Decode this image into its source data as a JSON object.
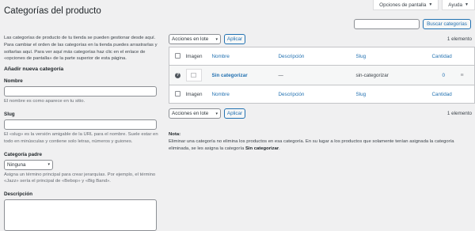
{
  "screen_options": {
    "screen_options_label": "Opciones de pantalla",
    "help_label": "Ayuda"
  },
  "page": {
    "title": "Categorías del producto"
  },
  "search": {
    "button_label": "Buscar categorías",
    "value": ""
  },
  "intro": "Las categorías de producto de tu tienda se pueden gestionar desde aquí. Para cambiar el orden de las categorías en la tienda puedes arrastrarlas y soltarlas aquí. Para ver aquí más categorías haz clic en el enlace de «opciones de pantalla» de la parte superior de esta página.",
  "form": {
    "heading": "Añadir nueva categoría",
    "name_label": "Nombre",
    "name_desc": "El nombre es como aparece en tu sitio.",
    "slug_label": "Slug",
    "slug_desc": "El «slug» es la versión amigable de la URL para el nombre. Suele estar en todo en minúsculas y contiene solo letras, números y guiones.",
    "parent_label": "Categoría padre",
    "parent_value": "Ninguna",
    "parent_desc": "Asigna un término principal para crear jerarquías. Por ejemplo, el término «Jazz» sería el principal de «Bebop» y «Big Band».",
    "description_label": "Descripción"
  },
  "tablenav": {
    "bulk_label": "Acciones en lote",
    "apply_label": "Aplicar",
    "count": "1 elemento"
  },
  "table": {
    "columns": {
      "image": "Imagen",
      "name": "Nombre",
      "description": "Descripción",
      "slug": "Slug",
      "count": "Cantidad"
    },
    "rows": [
      {
        "name": "Sin categorizar",
        "description": "—",
        "slug": "sin-categorizar",
        "count": "0"
      }
    ]
  },
  "note": {
    "label": "Nota:",
    "text_before": "Eliminar una categoría no elimina los productos en esa categoría. En su lugar a los productos que solamente tenían asignada la categoría eliminada, se les asigna la categoría ",
    "category": "Sin categorizar",
    "text_after": "."
  }
}
